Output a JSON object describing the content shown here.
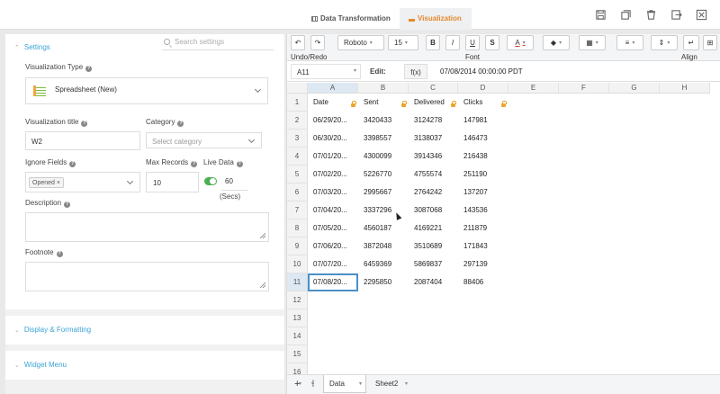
{
  "top_tabs": [
    {
      "label": "Data Transformation"
    },
    {
      "label": "Visualization"
    }
  ],
  "top_icons": [
    "save-icon",
    "copy-icon",
    "trash-icon",
    "export-icon",
    "close-icon"
  ],
  "settings": {
    "header": "Settings",
    "search_placeholder": "Search settings",
    "vis_type_label": "Visualization Type",
    "vis_type_value": "Spreadsheet (New)",
    "vis_title_label": "Visualization title",
    "vis_title_value": "W2",
    "category_label": "Category",
    "category_placeholder": "Select category",
    "ignore_label": "Ignore Fields",
    "ignore_chip": "Opened ×",
    "max_label": "Max Records",
    "max_value": "10",
    "live_label": "Live Data",
    "live_value": "60",
    "live_unit": "(Secs)",
    "desc_label": "Description",
    "foot_label": "Footnote"
  },
  "sections": [
    "Display & Formatting",
    "Widget Menu"
  ],
  "toolbar": {
    "font": "Roboto",
    "size": "15",
    "bold": "B",
    "italic": "I",
    "underline": "U",
    "strike": "S",
    "font_color": "A",
    "groups": [
      {
        "label": "Undo/Redo"
      },
      {
        "label": "Font"
      },
      {
        "label": "Align"
      }
    ]
  },
  "formula": {
    "cell_ref": "A11",
    "edit_label": "Edit:",
    "fx": "f(x)",
    "value": "07/08/2014 00:00:00 PDT"
  },
  "columns": [
    "A",
    "B",
    "C",
    "D",
    "E",
    "F",
    "G",
    "H"
  ],
  "rows": [
    [
      "Date",
      "Sent",
      "Delivered",
      "Clicks"
    ],
    [
      "06/29/20...",
      "3420433",
      "3124278",
      "147981"
    ],
    [
      "06/30/20...",
      "3398557",
      "3138037",
      "146473"
    ],
    [
      "07/01/20...",
      "4300099",
      "3914346",
      "216438"
    ],
    [
      "07/02/20...",
      "5226770",
      "4755574",
      "251190"
    ],
    [
      "07/03/20...",
      "2995667",
      "2764242",
      "137207"
    ],
    [
      "07/04/20...",
      "3337296",
      "3087068",
      "143536"
    ],
    [
      "07/05/20...",
      "4560187",
      "4169221",
      "211879"
    ],
    [
      "07/06/20...",
      "3872048",
      "3510689",
      "171843"
    ],
    [
      "07/07/20...",
      "6459369",
      "5869837",
      "297139"
    ],
    [
      "07/08/20...",
      "2295850",
      "2087404",
      "88406"
    ]
  ],
  "row_numbers": [
    "1",
    "2",
    "3",
    "4",
    "5",
    "6",
    "7",
    "8",
    "9",
    "10",
    "11",
    "12",
    "13",
    "14",
    "15",
    "16"
  ],
  "sheet_tabs": [
    {
      "label": "Data"
    },
    {
      "label": "Sheet2"
    }
  ]
}
